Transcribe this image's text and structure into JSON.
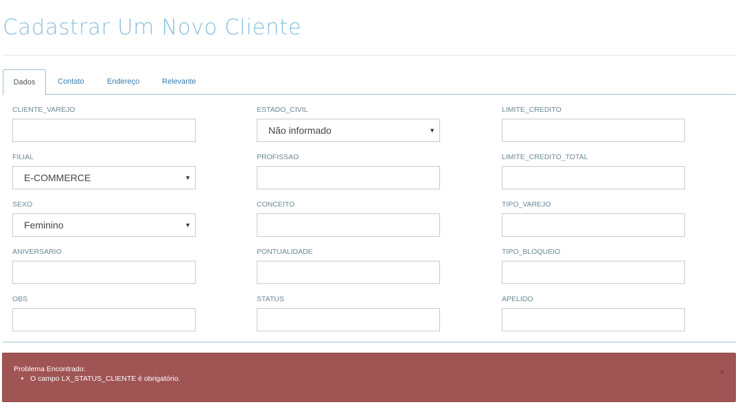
{
  "page": {
    "title": "Cadastrar Um Novo Cliente"
  },
  "tabs": [
    {
      "label": "Dados",
      "active": true
    },
    {
      "label": "Contato",
      "active": false
    },
    {
      "label": "Endereço",
      "active": false
    },
    {
      "label": "Relevante",
      "active": false
    }
  ],
  "form": {
    "cliente_varejo": {
      "label": "CLIENTE_VAREJO",
      "value": ""
    },
    "filial": {
      "label": "FILIAL",
      "value": "E-COMMERCE"
    },
    "sexo": {
      "label": "SEXO",
      "value": "Feminino"
    },
    "aniversario": {
      "label": "ANIVERSARIO",
      "value": ""
    },
    "obs": {
      "label": "OBS",
      "value": ""
    },
    "estado_civil": {
      "label": "ESTADO_CIVIL",
      "value": "Não informado"
    },
    "profissao": {
      "label": "PROFISSAO",
      "value": ""
    },
    "conceito": {
      "label": "CONCEITO",
      "value": ""
    },
    "pontualidade": {
      "label": "PONTUALIDADE",
      "value": ""
    },
    "status": {
      "label": "STATUS",
      "value": ""
    },
    "limite_credito": {
      "label": "LIMITE_CREDITO",
      "value": ""
    },
    "limite_credito_total": {
      "label": "LIMITE_CREDITO_TOTAL",
      "value": ""
    },
    "tipo_varejo": {
      "label": "TIPO_VAREJO",
      "value": ""
    },
    "tipo_bloqueio": {
      "label": "TIPO_BLOQUEIO",
      "value": ""
    },
    "apelido": {
      "label": "APELIDO",
      "value": ""
    }
  },
  "alert": {
    "title": "Problema Encontrado:",
    "messages": [
      "O campo LX_STATUS_CLIENTE é obrigatório."
    ],
    "close_label": "×",
    "color": "#a05454"
  },
  "icons": {
    "select_caret": "▼"
  },
  "colors": {
    "title": "#8ac0dc",
    "tab_link": "#3a7bb0",
    "label": "#6a8794",
    "alert_bg": "#a05454"
  }
}
